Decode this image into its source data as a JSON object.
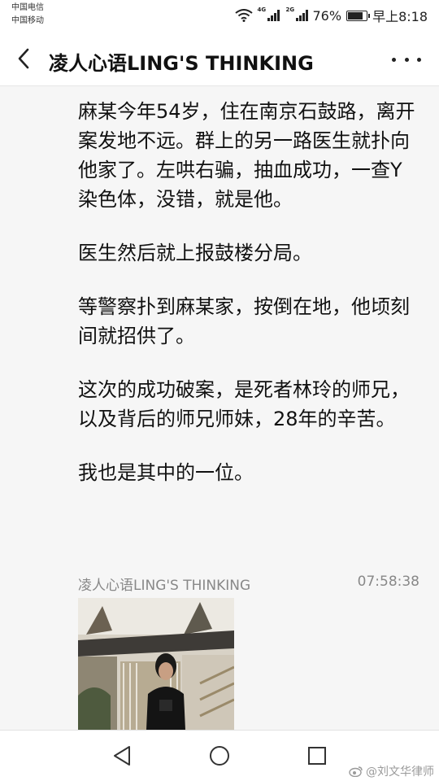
{
  "status_bar": {
    "carrier_1": "中国电信",
    "carrier_2": "中国移动",
    "network_1": "4G",
    "network_2": "2G",
    "battery_percent_text": "76%",
    "battery_level": 0.76,
    "time": "早上8:18"
  },
  "nav": {
    "title": "凌人心语LING'S THINKING",
    "back_icon": "chevron-left-icon",
    "more_icon": "more-dots-icon"
  },
  "article": {
    "paragraphs": [
      "麻某今年54岁，住在南京石鼓路，离开案发地不远。群上的另一路医生就扑向他家了。左哄右骗，抽血成功，一查Y染色体，没错，就是他。",
      "医生然后就上报鼓楼分局。",
      "等警察扑到麻某家，按倒在地，他顷刻间就招供了。",
      "这次的成功破案，是死者林玲的师兄，以及背后的师兄师妹，28年的辛苦。",
      "我也是其中的一位。"
    ]
  },
  "post": {
    "author": "凌人心语LING'S THINKING",
    "time": "07:58:38"
  },
  "system_nav": {
    "back_icon": "triangle-back-icon",
    "home_icon": "circle-home-icon",
    "recents_icon": "square-recents-icon"
  },
  "watermark": {
    "text": "@刘文华律师",
    "icon": "weibo-icon"
  }
}
